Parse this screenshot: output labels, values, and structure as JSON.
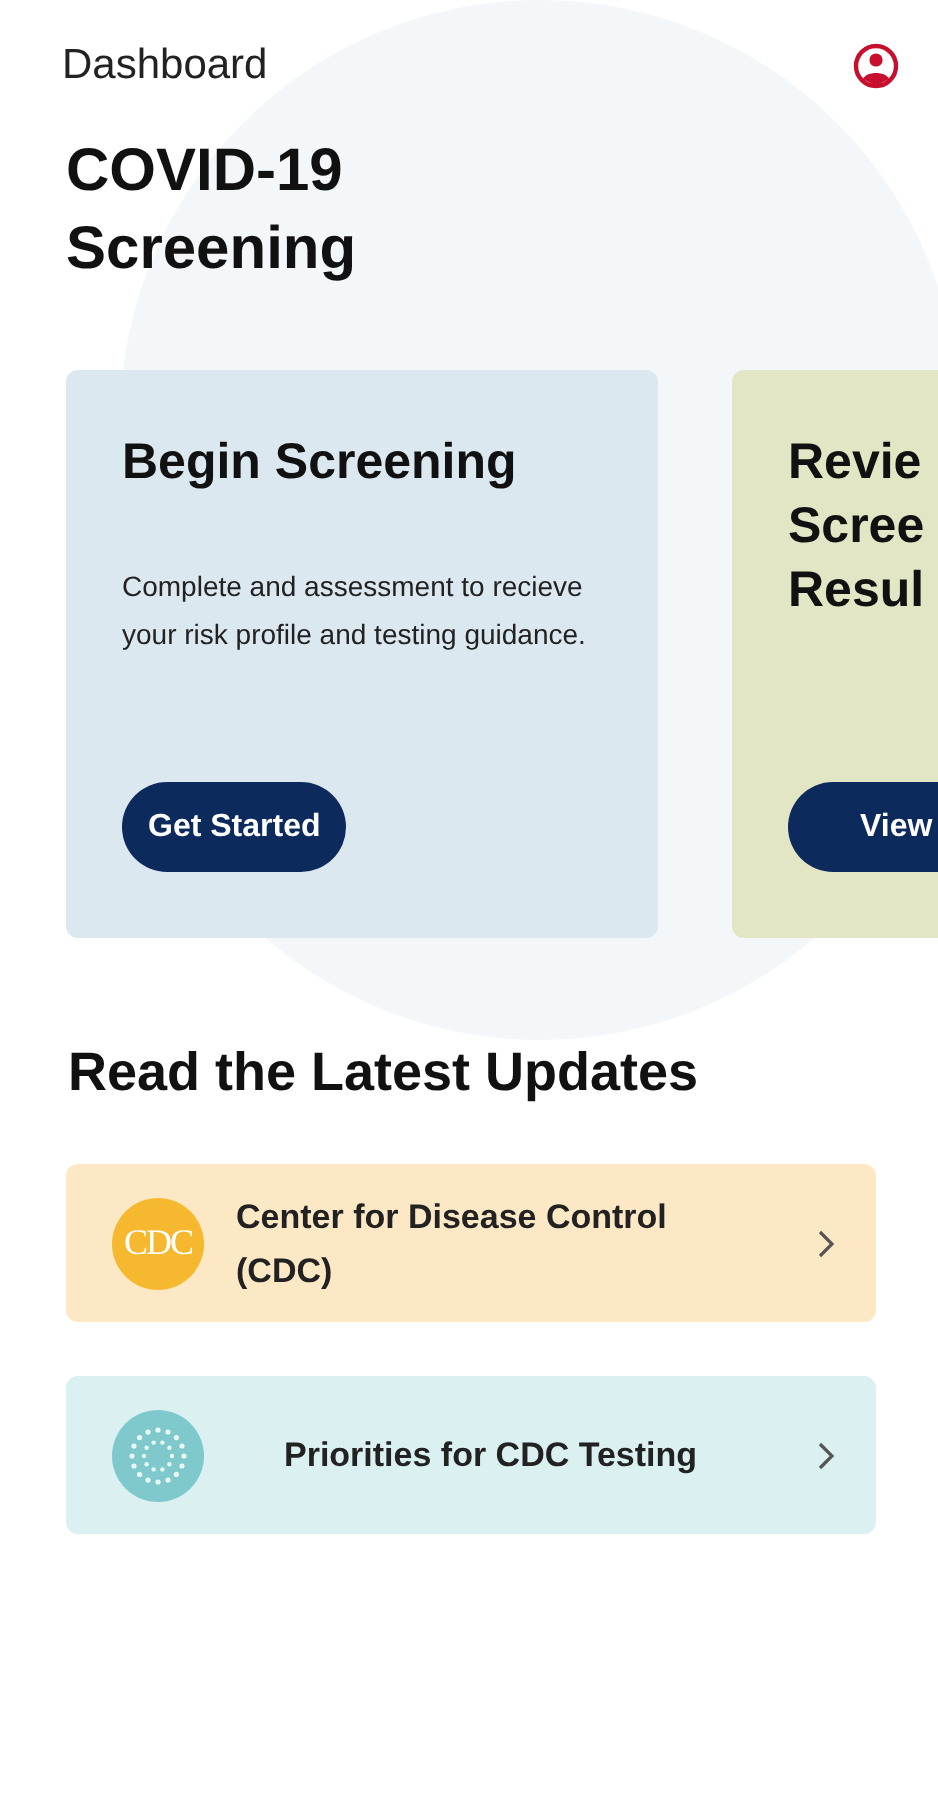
{
  "header": {
    "title": "Dashboard"
  },
  "heading": [
    "COVID-19",
    "Screening"
  ],
  "cards": [
    {
      "title_lines": [
        "Begin Screening"
      ],
      "description": "Complete and assessment to recieve your risk profile and testing guidance.",
      "button": "Get Started",
      "color": "#dce8f0"
    },
    {
      "title_lines": [
        "Revie",
        "Scree",
        "Resul"
      ],
      "button": "View",
      "color": "#e2e6c4"
    }
  ],
  "updates_heading": "Read the Latest Updates",
  "updates": [
    {
      "kind": "logo",
      "icon_text": "CDC",
      "label": "Center for Disease Control (CDC)",
      "color": "#fde8c6"
    },
    {
      "kind": "dots",
      "label": "Priorities for CDC Testing",
      "color": "#daf0f1"
    }
  ]
}
